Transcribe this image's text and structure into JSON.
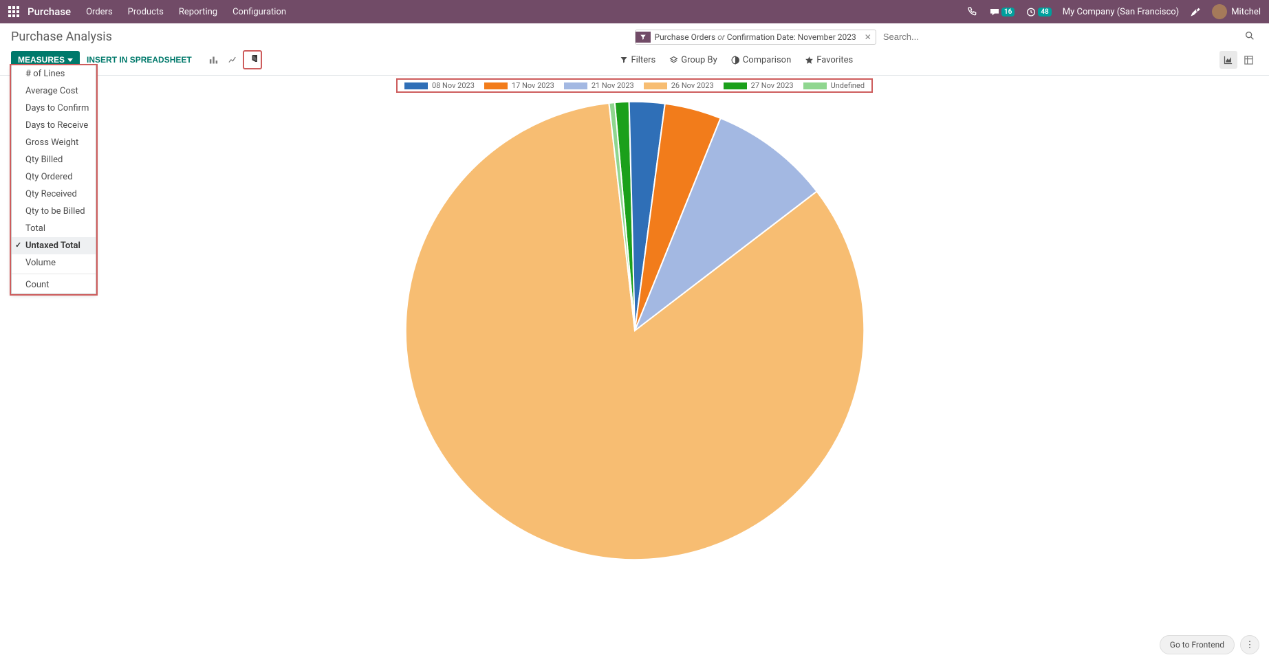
{
  "topbar": {
    "brand": "Purchase",
    "nav": [
      "Orders",
      "Products",
      "Reporting",
      "Configuration"
    ],
    "company": "My Company (San Francisco)",
    "user": "Mitchel",
    "msg_badge": "16",
    "timer_badge": "48"
  },
  "header": {
    "title": "Purchase Analysis",
    "filter_chip_prefix": "Purchase Orders",
    "filter_chip_or": "or",
    "filter_chip_suffix": "Confirmation Date: November 2023",
    "search_placeholder": "Search..."
  },
  "toolbar": {
    "measures_label": "MEASURES",
    "insert_label": "INSERT IN SPREADSHEET",
    "filters": "Filters",
    "groupby": "Group By",
    "comparison": "Comparison",
    "favorites": "Favorites"
  },
  "measures": {
    "items": [
      "# of Lines",
      "Average Cost",
      "Days to Confirm",
      "Days to Receive",
      "Gross Weight",
      "Qty Billed",
      "Qty Ordered",
      "Qty Received",
      "Qty to be Billed",
      "Total",
      "Untaxed Total",
      "Volume"
    ],
    "selected": "Untaxed Total",
    "count_label": "Count"
  },
  "chart_data": {
    "type": "pie",
    "title": "",
    "series": [
      {
        "name": "08 Nov 2023",
        "value": 2.5,
        "color": "#2f6fb7"
      },
      {
        "name": "17 Nov 2023",
        "value": 4.0,
        "color": "#f27c1b"
      },
      {
        "name": "21 Nov 2023",
        "value": 8.5,
        "color": "#a3b8e2"
      },
      {
        "name": "26 Nov 2023",
        "value": 83.6,
        "color": "#f7bd72"
      },
      {
        "name": "27 Nov 2023",
        "value": 1.0,
        "color": "#1ba01b"
      },
      {
        "name": "Undefined",
        "value": 0.4,
        "color": "#8fd68f"
      }
    ]
  },
  "footer": {
    "frontend": "Go to Frontend"
  }
}
